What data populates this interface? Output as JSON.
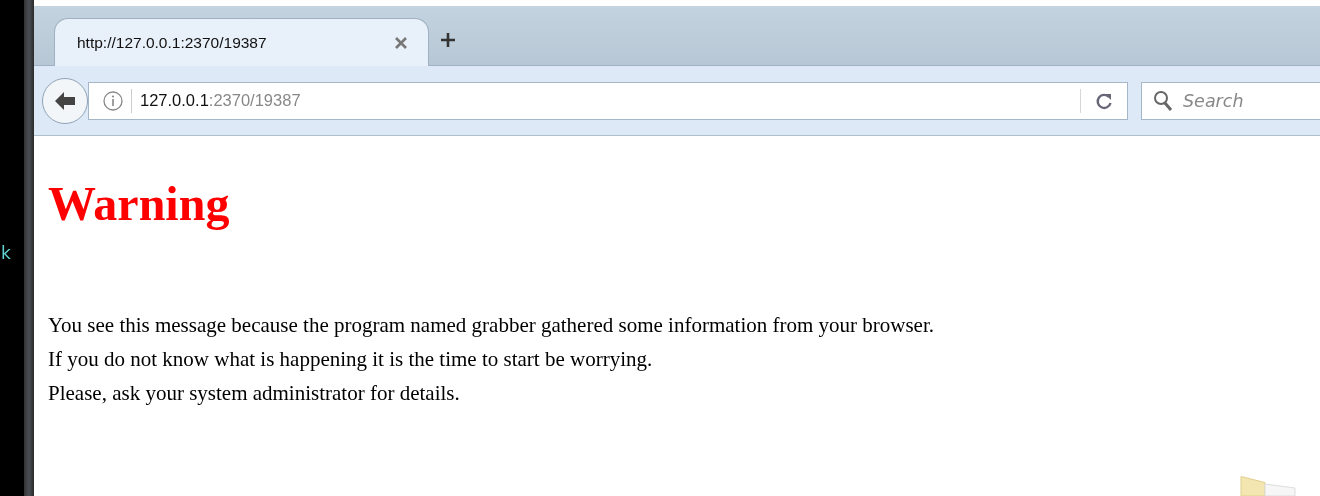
{
  "background_window": {
    "text": "k"
  },
  "tabs": [
    {
      "title": "http://127.0.0.1:2370/19387",
      "selected": true
    }
  ],
  "address_bar": {
    "host": "127.0.0.1",
    "path": ":2370/19387"
  },
  "search": {
    "placeholder": "Search"
  },
  "page": {
    "heading": "Warning",
    "paragraphs": [
      "You see this message because the program named grabber gathered some information from your browser.",
      "If you do not know what is happening it is the time to start be worrying.",
      "Please, ask your system administrator for details."
    ]
  }
}
